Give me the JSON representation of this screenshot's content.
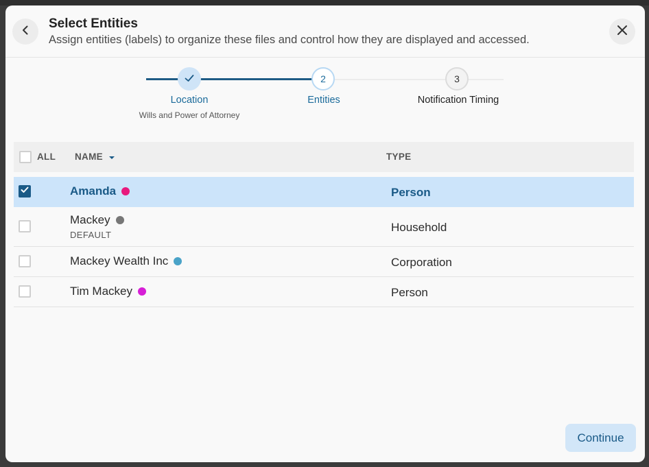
{
  "header": {
    "title": "Select Entities",
    "subtitle": "Assign entities (labels) to organize these files and control how they are displayed and accessed."
  },
  "stepper": {
    "steps": [
      {
        "label": "Location",
        "sublabel": "Wills and Power of Attorney",
        "status": "complete"
      },
      {
        "label": "Entities",
        "number": "2",
        "status": "active"
      },
      {
        "label": "Notification Timing",
        "number": "3",
        "status": "upcoming"
      }
    ]
  },
  "table": {
    "headers": {
      "all": "ALL",
      "name": "NAME",
      "type": "TYPE"
    },
    "sort": {
      "column": "name",
      "direction": "descending"
    },
    "rows": [
      {
        "name": "Amanda",
        "sub": "",
        "type": "Person",
        "checked": true,
        "dot_color": "#e8197d"
      },
      {
        "name": "Mackey",
        "sub": "DEFAULT",
        "type": "Household",
        "checked": false,
        "dot_color": "#777777"
      },
      {
        "name": "Mackey Wealth Inc",
        "sub": "",
        "type": "Corporation",
        "checked": false,
        "dot_color": "#4aa3c8"
      },
      {
        "name": "Tim Mackey",
        "sub": "",
        "type": "Person",
        "checked": false,
        "dot_color": "#d61fd6"
      }
    ]
  },
  "footer": {
    "continue_label": "Continue"
  },
  "colors": {
    "accent": "#1a5a87",
    "selected_row": "#cce4fa",
    "progress_line": "#1e5b85"
  }
}
